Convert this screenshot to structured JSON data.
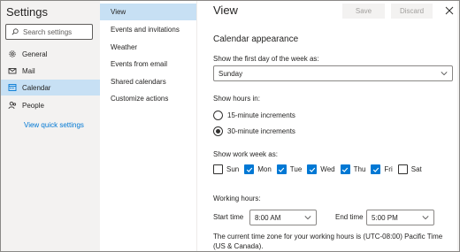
{
  "settings": {
    "title": "Settings",
    "search_placeholder": "Search settings",
    "nav": [
      {
        "label": "General",
        "icon": "gear-icon",
        "selected": false
      },
      {
        "label": "Mail",
        "icon": "mail-icon",
        "selected": false
      },
      {
        "label": "Calendar",
        "icon": "calendar-icon",
        "selected": true
      },
      {
        "label": "People",
        "icon": "people-icon",
        "selected": false
      }
    ],
    "quick_link": "View quick settings"
  },
  "submenu": [
    {
      "label": "View",
      "selected": true
    },
    {
      "label": "Events and invitations",
      "selected": false
    },
    {
      "label": "Weather",
      "selected": false
    },
    {
      "label": "Events from email",
      "selected": false
    },
    {
      "label": "Shared calendars",
      "selected": false
    },
    {
      "label": "Customize actions",
      "selected": false
    }
  ],
  "content": {
    "title": "View",
    "save_label": "Save",
    "discard_label": "Discard",
    "section_title": "Calendar appearance",
    "first_day_label": "Show the first day of the week as:",
    "first_day_value": "Sunday",
    "hours_label": "Show hours in:",
    "hours_options": [
      {
        "label": "15-minute increments",
        "checked": false
      },
      {
        "label": "30-minute increments",
        "checked": true
      }
    ],
    "work_week_label": "Show work week as:",
    "days": [
      {
        "label": "Sun",
        "checked": false
      },
      {
        "label": "Mon",
        "checked": true
      },
      {
        "label": "Tue",
        "checked": true
      },
      {
        "label": "Wed",
        "checked": true
      },
      {
        "label": "Thu",
        "checked": true
      },
      {
        "label": "Fri",
        "checked": true
      },
      {
        "label": "Sat",
        "checked": false
      }
    ],
    "working_hours_label": "Working hours:",
    "start_time_label": "Start time",
    "start_time_value": "8:00 AM",
    "end_time_label": "End time",
    "end_time_value": "5:00 PM",
    "timezone_note": "The current time zone for your working hours is (UTC-08:00) Pacific Time (US & Canada)."
  },
  "colors": {
    "accent": "#0078d4",
    "selected_bg": "#c7e0f4",
    "pane_bg": "#f3f2f1"
  }
}
